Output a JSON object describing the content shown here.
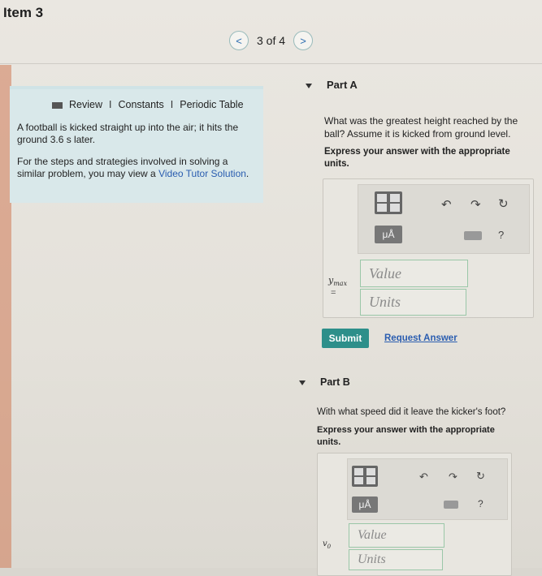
{
  "header": {
    "item_title": "Item 3",
    "pager_text": "3 of 4",
    "prev_glyph": "<",
    "next_glyph": ">"
  },
  "review": {
    "tab_review": "Review",
    "separator": "I",
    "tab_constants": "Constants",
    "tab_periodic": "Periodic Table",
    "problem_text": "A football is kicked straight up into the air; it hits the ground 3.6  s later.",
    "help_text_prefix": "For the steps and strategies involved in solving a similar problem, you may view a ",
    "help_link": "Video Tutor Solution",
    "help_text_suffix": "."
  },
  "part_a": {
    "label": "Part A",
    "question": "What was the greatest height reached by the ball? Assume it is kicked from ground level.",
    "instruction": "Express your answer with the appropriate units.",
    "mu_label": "μÅ",
    "help_glyph": "?",
    "variable": "y",
    "variable_sub": "max",
    "equals": "=",
    "value_placeholder": "Value",
    "units_placeholder": "Units",
    "submit_label": "Submit",
    "request_label": "Request Answer"
  },
  "part_b": {
    "label": "Part B",
    "question": "With what speed did it leave the kicker's foot?",
    "instruction": "Express your answer with the appropriate units.",
    "mu_label": "μÅ",
    "help_glyph": "?",
    "variable": "v",
    "variable_sub": "0",
    "value_placeholder": "Value",
    "units_placeholder": "Units"
  }
}
